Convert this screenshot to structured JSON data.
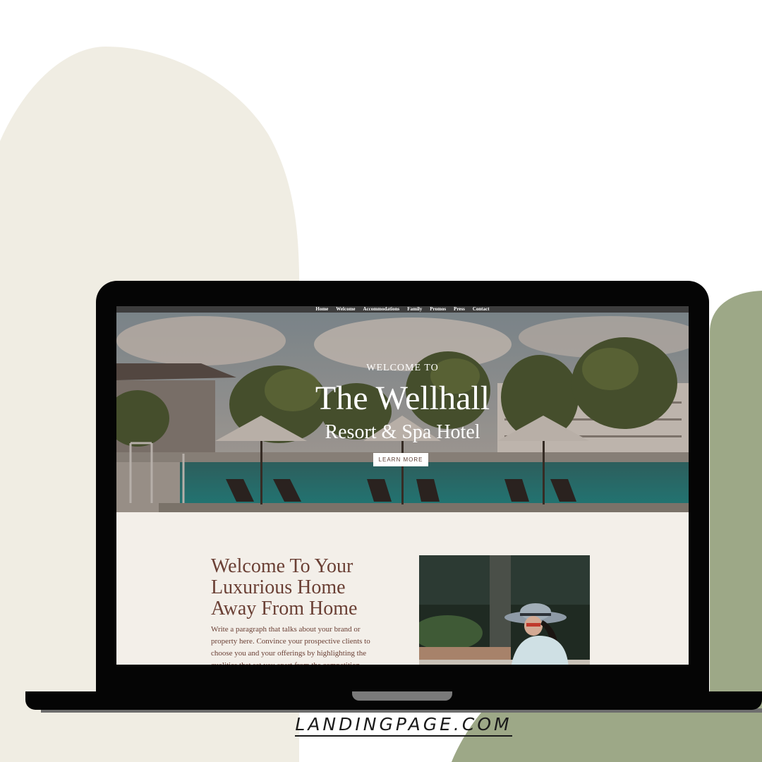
{
  "colors": {
    "cream_blob": "#f0ede3",
    "green_blob": "#9da887",
    "laptop": "#050505",
    "nav_bg": "#3d3d3d",
    "section_bg": "#f3efe9",
    "brand_brown": "#6a3f34"
  },
  "nav": {
    "items": [
      "Home",
      "Welcome",
      "Accommodations",
      "Family",
      "Promos",
      "Press",
      "Contact"
    ]
  },
  "hero": {
    "kicker": "WELCOME TO",
    "title": "The Wellhall",
    "subtitle": "Resort & Spa Hotel",
    "button_label": "LEARN MORE"
  },
  "intro": {
    "title": "Welcome To Your Luxurious Home Away From Home",
    "body": "Write a paragraph that talks about your brand or property here. Convince your prospective clients to choose you and your offerings by highlighting the qualities that set you apart from the competition."
  },
  "footer": {
    "brand": "LANDINGPAGE.COM"
  }
}
